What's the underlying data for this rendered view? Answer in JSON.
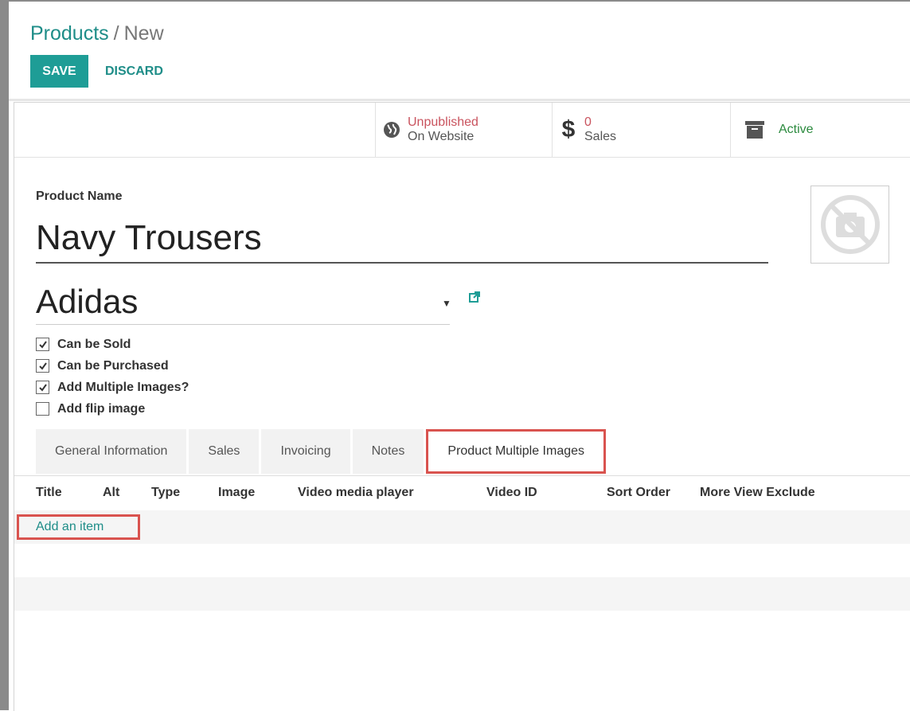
{
  "breadcrumb": {
    "parent": "Products",
    "separator": "/",
    "current": "New"
  },
  "toolbar": {
    "save_label": "SAVE",
    "discard_label": "DISCARD"
  },
  "stat_buttons": {
    "website": {
      "top": "Unpublished",
      "bottom": "On Website",
      "top_color": "#c9535e"
    },
    "sales": {
      "top": "0",
      "bottom": "Sales"
    },
    "active": {
      "label": "Active",
      "color": "#2b8a3e"
    }
  },
  "form": {
    "product_name_label": "Product Name",
    "product_name": "Navy Trousers",
    "brand": "Adidas",
    "checkboxes": [
      {
        "label": "Can be Sold",
        "checked": true
      },
      {
        "label": "Can be Purchased",
        "checked": true
      },
      {
        "label": "Add Multiple Images?",
        "checked": true
      },
      {
        "label": "Add flip image",
        "checked": false
      }
    ]
  },
  "tabs": [
    {
      "label": "General Information",
      "active": false
    },
    {
      "label": "Sales",
      "active": false
    },
    {
      "label": "Invoicing",
      "active": false
    },
    {
      "label": "Notes",
      "active": false
    },
    {
      "label": "Product Multiple Images",
      "active": true
    }
  ],
  "table": {
    "columns": [
      "Title",
      "Alt",
      "Type",
      "Image",
      "Video media player",
      "Video ID",
      "Sort Order",
      "More View Exclude"
    ],
    "add_item_label": "Add an item"
  },
  "colors": {
    "accent": "#1e9d96",
    "highlight": "#d9534f"
  }
}
